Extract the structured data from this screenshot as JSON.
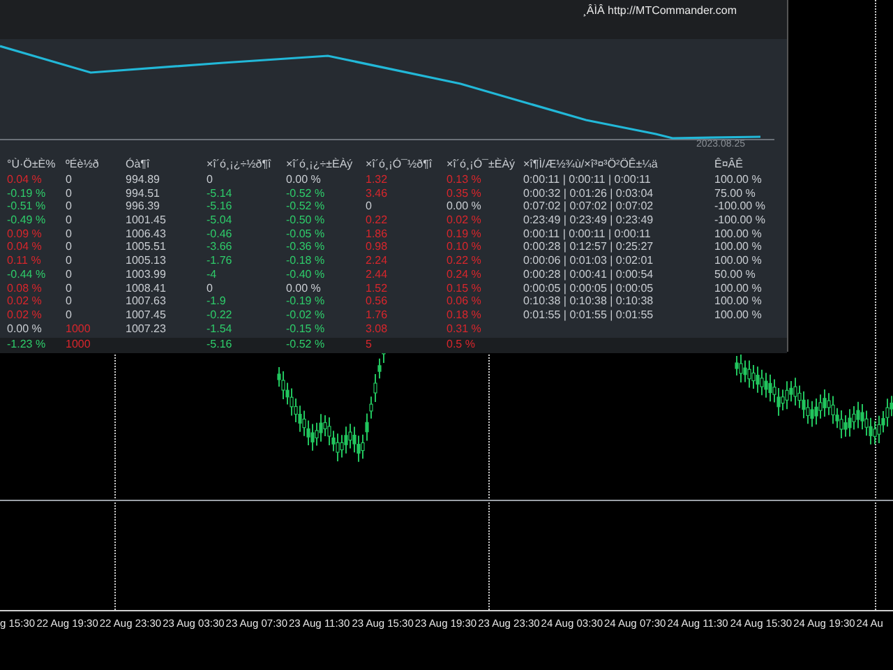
{
  "panel": {
    "link": "¸ÂÌÂ http://MTCommander.com",
    "equity_date": "2023.08.25",
    "table": {
      "columns": [
        "°Ù·Ö±È%",
        "ºÉè½ð",
        "Óà¶î",
        "×î´ó¸¡¿÷½ð¶î",
        "×î´ó¸¡¿÷±ÈÀý",
        "×î´ó¸¡Ó¯½ð¶î",
        "×î´ó¸¡Ó¯±ÈÀý",
        "×î¶Ì/Æ½¾ù/×î³¤³Ö²ÖÊ±¼ä",
        "Ê¤ÂÊ"
      ],
      "rows": [
        {
          "total": false,
          "cells": [
            {
              "text": "0.04 %",
              "color": "#d9262c"
            },
            {
              "text": "0"
            },
            {
              "text": "994.89"
            },
            {
              "text": "0"
            },
            {
              "text": "0.00 %"
            },
            {
              "text": "1.32",
              "color": "#d9262c"
            },
            {
              "text": "0.13 %",
              "color": "#d9262c"
            },
            {
              "text": "0:00:11 | 0:00:11 | 0:00:11"
            },
            {
              "text": "100.00 %"
            }
          ]
        },
        {
          "total": false,
          "cells": [
            {
              "text": "-0.19 %",
              "color": "#2ecc6a"
            },
            {
              "text": "0"
            },
            {
              "text": "994.51"
            },
            {
              "text": "-5.14",
              "color": "#2ecc6a"
            },
            {
              "text": "-0.52 %",
              "color": "#2ecc6a"
            },
            {
              "text": "3.46",
              "color": "#d9262c"
            },
            {
              "text": "0.35 %",
              "color": "#d9262c"
            },
            {
              "text": "0:00:32 | 0:01:26 | 0:03:04"
            },
            {
              "text": "75.00 %"
            }
          ]
        },
        {
          "total": false,
          "cells": [
            {
              "text": "-0.51 %",
              "color": "#2ecc6a"
            },
            {
              "text": "0"
            },
            {
              "text": "996.39"
            },
            {
              "text": "-5.16",
              "color": "#2ecc6a"
            },
            {
              "text": "-0.52 %",
              "color": "#2ecc6a"
            },
            {
              "text": "0"
            },
            {
              "text": "0.00 %"
            },
            {
              "text": "0:07:02 | 0:07:02 | 0:07:02"
            },
            {
              "text": "-100.00 %"
            }
          ]
        },
        {
          "total": false,
          "cells": [
            {
              "text": "-0.49 %",
              "color": "#2ecc6a"
            },
            {
              "text": "0"
            },
            {
              "text": "1001.45"
            },
            {
              "text": "-5.04",
              "color": "#2ecc6a"
            },
            {
              "text": "-0.50 %",
              "color": "#2ecc6a"
            },
            {
              "text": "0.22",
              "color": "#d9262c"
            },
            {
              "text": "0.02 %",
              "color": "#d9262c"
            },
            {
              "text": "0:23:49 | 0:23:49 | 0:23:49"
            },
            {
              "text": "-100.00 %"
            }
          ]
        },
        {
          "total": false,
          "cells": [
            {
              "text": "0.09 %",
              "color": "#d9262c"
            },
            {
              "text": "0"
            },
            {
              "text": "1006.43"
            },
            {
              "text": "-0.46",
              "color": "#2ecc6a"
            },
            {
              "text": "-0.05 %",
              "color": "#2ecc6a"
            },
            {
              "text": "1.86",
              "color": "#d9262c"
            },
            {
              "text": "0.19 %",
              "color": "#d9262c"
            },
            {
              "text": "0:00:11 | 0:00:11 | 0:00:11"
            },
            {
              "text": "100.00 %"
            }
          ]
        },
        {
          "total": false,
          "cells": [
            {
              "text": "0.04 %",
              "color": "#d9262c"
            },
            {
              "text": "0"
            },
            {
              "text": "1005.51"
            },
            {
              "text": "-3.66",
              "color": "#2ecc6a"
            },
            {
              "text": "-0.36 %",
              "color": "#2ecc6a"
            },
            {
              "text": "0.98",
              "color": "#d9262c"
            },
            {
              "text": "0.10 %",
              "color": "#d9262c"
            },
            {
              "text": "0:00:28 | 0:12:57 | 0:25:27"
            },
            {
              "text": "100.00 %"
            }
          ]
        },
        {
          "total": false,
          "cells": [
            {
              "text": "0.11 %",
              "color": "#d9262c"
            },
            {
              "text": "0"
            },
            {
              "text": "1005.13"
            },
            {
              "text": "-1.76",
              "color": "#2ecc6a"
            },
            {
              "text": "-0.18 %",
              "color": "#2ecc6a"
            },
            {
              "text": "2.24",
              "color": "#d9262c"
            },
            {
              "text": "0.22 %",
              "color": "#d9262c"
            },
            {
              "text": "0:00:06 | 0:01:03 | 0:02:01"
            },
            {
              "text": "100.00 %"
            }
          ]
        },
        {
          "total": false,
          "cells": [
            {
              "text": "-0.44 %",
              "color": "#2ecc6a"
            },
            {
              "text": "0"
            },
            {
              "text": "1003.99"
            },
            {
              "text": "-4",
              "color": "#2ecc6a"
            },
            {
              "text": "-0.40 %",
              "color": "#2ecc6a"
            },
            {
              "text": "2.44",
              "color": "#d9262c"
            },
            {
              "text": "0.24 %",
              "color": "#d9262c"
            },
            {
              "text": "0:00:28 | 0:00:41 | 0:00:54"
            },
            {
              "text": "50.00 %"
            }
          ]
        },
        {
          "total": false,
          "cells": [
            {
              "text": "0.08 %",
              "color": "#d9262c"
            },
            {
              "text": "0"
            },
            {
              "text": "1008.41"
            },
            {
              "text": "0"
            },
            {
              "text": "0.00 %"
            },
            {
              "text": "1.52",
              "color": "#d9262c"
            },
            {
              "text": "0.15 %",
              "color": "#d9262c"
            },
            {
              "text": "0:00:05 | 0:00:05 | 0:00:05"
            },
            {
              "text": "100.00 %"
            }
          ]
        },
        {
          "total": false,
          "cells": [
            {
              "text": "0.02 %",
              "color": "#d9262c"
            },
            {
              "text": "0"
            },
            {
              "text": "1007.63"
            },
            {
              "text": "-1.9",
              "color": "#2ecc6a"
            },
            {
              "text": "-0.19 %",
              "color": "#2ecc6a"
            },
            {
              "text": "0.56",
              "color": "#d9262c"
            },
            {
              "text": "0.06 %",
              "color": "#d9262c"
            },
            {
              "text": "0:10:38 | 0:10:38 | 0:10:38"
            },
            {
              "text": "100.00 %"
            }
          ]
        },
        {
          "total": false,
          "cells": [
            {
              "text": "0.02 %",
              "color": "#d9262c"
            },
            {
              "text": "0"
            },
            {
              "text": "1007.45"
            },
            {
              "text": "-0.22",
              "color": "#2ecc6a"
            },
            {
              "text": "-0.02 %",
              "color": "#2ecc6a"
            },
            {
              "text": "1.76",
              "color": "#d9262c"
            },
            {
              "text": "0.18 %",
              "color": "#d9262c"
            },
            {
              "text": "0:01:55 | 0:01:55 | 0:01:55"
            },
            {
              "text": "100.00 %"
            }
          ]
        },
        {
          "total": false,
          "cells": [
            {
              "text": "0.00 %"
            },
            {
              "text": "1000",
              "color": "#d9262c"
            },
            {
              "text": "1007.23"
            },
            {
              "text": "-1.54",
              "color": "#2ecc6a"
            },
            {
              "text": "-0.15 %",
              "color": "#2ecc6a"
            },
            {
              "text": "3.08",
              "color": "#d9262c"
            },
            {
              "text": "0.31 %",
              "color": "#d9262c"
            }
          ]
        },
        {
          "total": true,
          "cells": [
            {
              "text": "-1.23 %",
              "color": "#2ecc6a"
            },
            {
              "text": "1000",
              "color": "#d9262c"
            },
            null,
            {
              "text": "-5.16",
              "color": "#2ecc6a"
            },
            {
              "text": "-0.52 %",
              "color": "#2ecc6a"
            },
            {
              "text": "5",
              "color": "#d9262c"
            },
            {
              "text": "0.5 %",
              "color": "#d9262c"
            }
          ]
        }
      ]
    }
  },
  "time_axis": [
    "g 15:30",
    "22 Aug 19:30",
    "22 Aug 23:30",
    "23 Aug 03:30",
    "23 Aug 07:30",
    "23 Aug 11:30",
    "23 Aug 15:30",
    "23 Aug 19:30",
    "23 Aug 23:30",
    "24 Aug 03:30",
    "24 Aug 07:30",
    "24 Aug 11:30",
    "24 Aug 15:30",
    "24 Aug 19:30",
    "24 Au"
  ]
}
